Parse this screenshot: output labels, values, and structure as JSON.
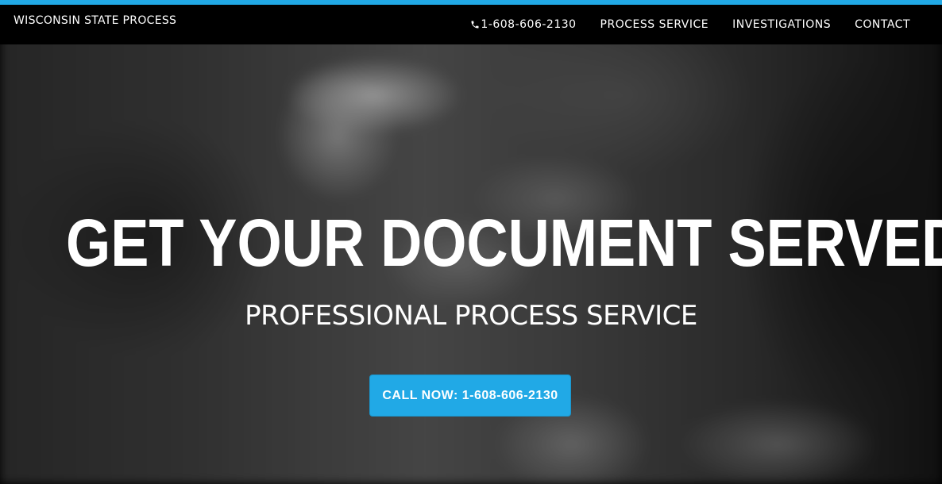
{
  "colors": {
    "accent": "#21a9e6",
    "navbar_bg": "#000000",
    "text": "#ffffff"
  },
  "navbar": {
    "brand": "WISCONSIN STATE PROCESS",
    "phone_icon": "phone-icon",
    "links": [
      {
        "label": "1-608-606-2130"
      },
      {
        "label": "PROCESS SERVICE"
      },
      {
        "label": "INVESTIGATIONS"
      },
      {
        "label": "CONTACT"
      }
    ]
  },
  "hero": {
    "title": "GET YOUR DOCUMENT SERVED",
    "subtitle": "PROFESSIONAL PROCESS SERVICE",
    "cta_label": "CALL NOW: 1-608-606-2130"
  }
}
